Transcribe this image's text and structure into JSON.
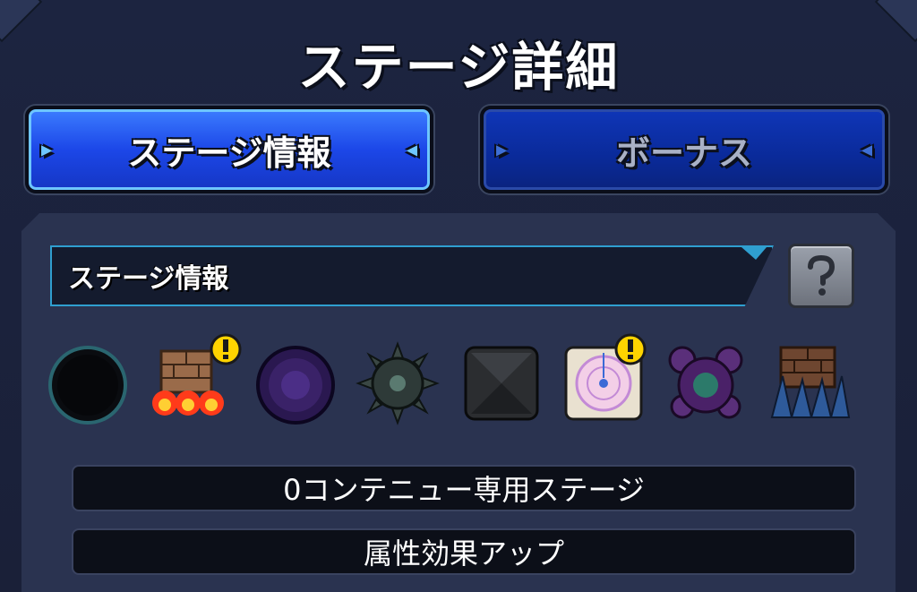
{
  "header": {
    "title": "ステージ詳細"
  },
  "tabs": [
    {
      "label": "ステージ情報",
      "active": true
    },
    {
      "label": "ボーナス",
      "active": false
    }
  ],
  "section": {
    "title": "ステージ情報",
    "help_icon": "question-mark-icon"
  },
  "gimmick_icons": [
    {
      "name": "dark-vortex-icon",
      "warning": false
    },
    {
      "name": "brick-wall-fire-icon",
      "warning": true
    },
    {
      "name": "black-hole-icon",
      "warning": false
    },
    {
      "name": "spiked-mine-icon",
      "warning": false
    },
    {
      "name": "black-block-icon",
      "warning": false
    },
    {
      "name": "magic-circle-panel-icon",
      "warning": true
    },
    {
      "name": "purple-gear-shield-icon",
      "warning": false
    },
    {
      "name": "brick-wall-spikes-icon",
      "warning": false
    }
  ],
  "info": [
    {
      "text": "0コンテニュー専用ステージ"
    },
    {
      "text": "属性効果アップ"
    }
  ],
  "colors": {
    "active_tab": "#1c47e8",
    "inactive_tab": "#0a2a99",
    "warning": "#ffd400"
  }
}
